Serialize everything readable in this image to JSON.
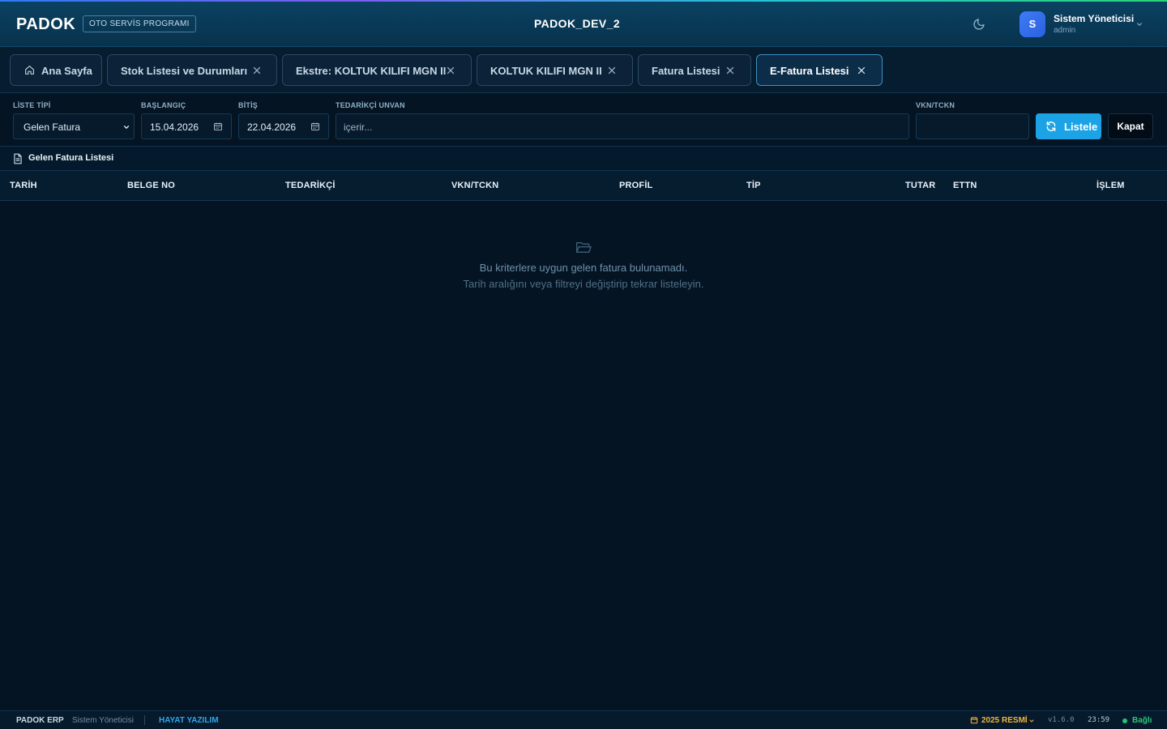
{
  "header": {
    "logo": "PADOK",
    "badge": "OTO SERVİS PROGRAMI",
    "title": "PADOK_DEV_2",
    "user_name": "Sistem Yöneticisi",
    "user_role": "admin",
    "avatar_letter": "S"
  },
  "tabs": [
    {
      "label": "Ana Sayfa",
      "icon": "home-icon",
      "closable": false
    },
    {
      "label": "Stok Listesi ve Durumları",
      "closable": true
    },
    {
      "label": "Ekstre: KOLTUK KILIFI MGN II",
      "closable": true
    },
    {
      "label": "KOLTUK KILIFI MGN II",
      "closable": true
    },
    {
      "label": "Fatura Listesi",
      "closable": true
    },
    {
      "label": "E-Fatura Listesi",
      "closable": true,
      "active": true
    }
  ],
  "filters": {
    "list_type_label": "LİSTE TİPİ",
    "list_type_value": "Gelen Fatura",
    "start_label": "BAŞLANGIÇ",
    "start_value": "15.04.2026",
    "end_label": "BİTİŞ",
    "end_value": "22.04.2026",
    "supplier_label": "TEDARİKÇİ UNVAN",
    "supplier_placeholder": "içerir...",
    "vkn_label": "VKN/TCKN",
    "vkn_value": "",
    "list_button": "Listele",
    "close_button": "Kapat"
  },
  "section": {
    "title": "Gelen Fatura Listesi"
  },
  "table": {
    "columns": [
      "TARİH",
      "BELGE NO",
      "TEDARİKÇİ",
      "VKN/TCKN",
      "PROFİL",
      "TİP",
      "TUTAR",
      "ETTN",
      "İŞLEM"
    ],
    "rows": []
  },
  "empty": {
    "line1": "Bu kriterlere uygun gelen fatura bulunamadı.",
    "line2": "Tarih aralığını veya filtreyi değiştirip tekrar listeleyin."
  },
  "status": {
    "app": "PADOK ERP",
    "user": "Sistem Yöneticisi",
    "company": "HAYAT YAZILIM",
    "period": "2025 RESMİ",
    "version": "v1.6.0",
    "time": "23:59",
    "connection": "Bağlı"
  },
  "colors": {
    "accent": "#1ca3e6",
    "period": "#f2b33d",
    "connected": "#22c37a"
  }
}
